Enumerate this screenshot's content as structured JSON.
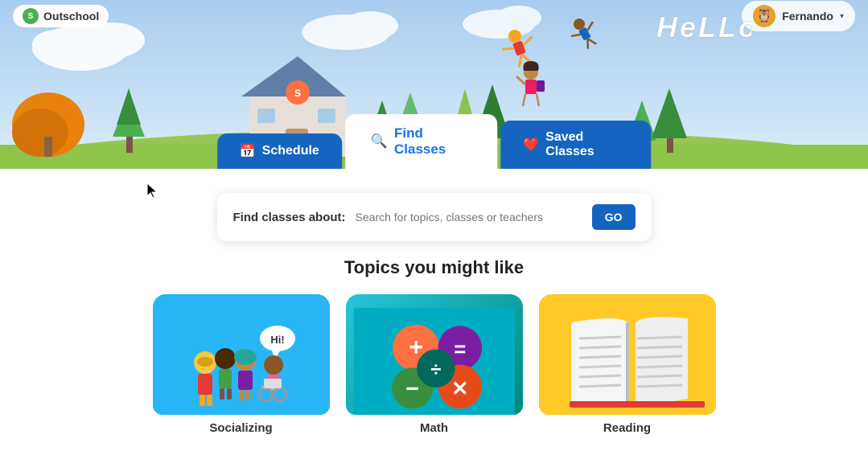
{
  "logo": {
    "text": "Outschool",
    "icon": "S"
  },
  "hello": "HeLLo",
  "user": {
    "name": "Fernando",
    "avatar": "🦉"
  },
  "tabs": [
    {
      "id": "schedule",
      "label": "Schedule",
      "icon": "📅",
      "active": false
    },
    {
      "id": "find",
      "label": "Find Classes",
      "icon": "🔍",
      "active": true
    },
    {
      "id": "saved",
      "label": "Saved Classes",
      "icon": "❤️",
      "active": false
    }
  ],
  "search": {
    "label": "Find classes about:",
    "placeholder": "Search for topics, classes or teachers",
    "button_label": "GO"
  },
  "topics": {
    "title": "Topics you might like",
    "cards": [
      {
        "id": "social",
        "label": "Socializing",
        "color_from": "#29b6f6",
        "color_to": "#0288d1"
      },
      {
        "id": "math",
        "label": "Math",
        "color_from": "#26c6da",
        "color_to": "#00897b"
      },
      {
        "id": "reading",
        "label": "Reading",
        "color_from": "#ffd54f",
        "color_to": "#ffb300"
      }
    ]
  },
  "colors": {
    "nav_blue": "#1565c0",
    "tab_active_bg": "white",
    "tab_active_text": "#1a73e8",
    "go_button": "#1565c0"
  }
}
